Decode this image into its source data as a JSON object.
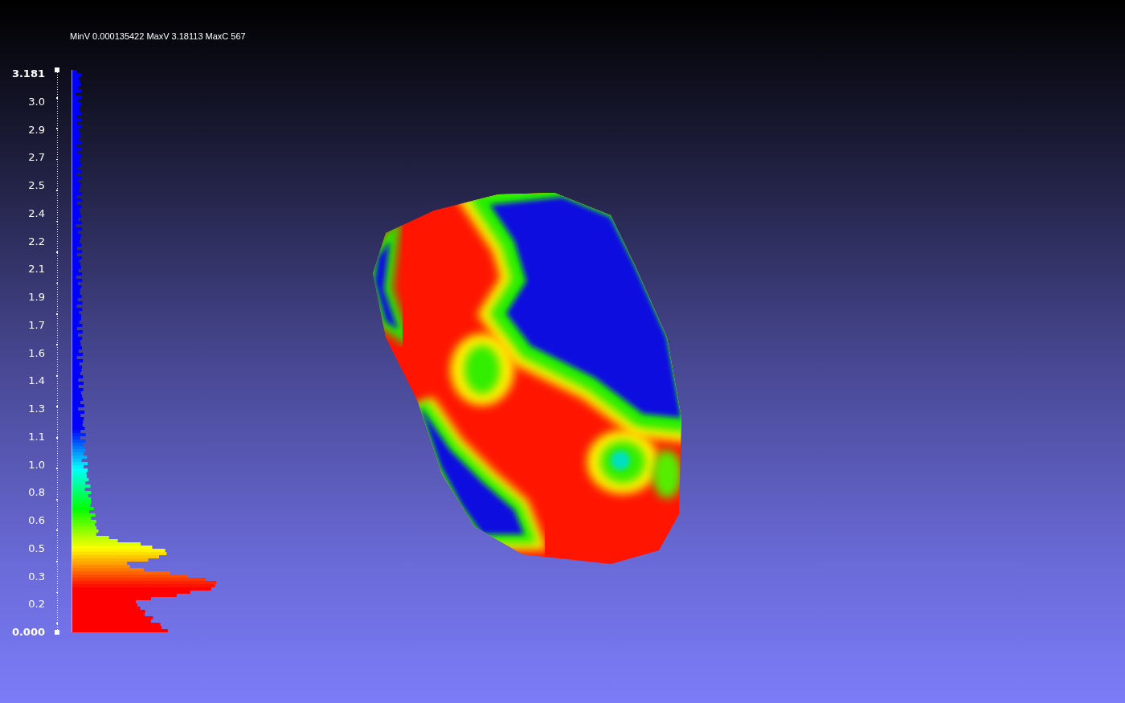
{
  "info_text": "MinV 0.000135422 MaxV 3.18113 MaxC 567",
  "colorbar": {
    "ticks": [
      "3.181",
      "3.0",
      "2.9",
      "2.7",
      "2.5",
      "2.4",
      "2.2",
      "2.1",
      "1.9",
      "1.7",
      "1.6",
      "1.4",
      "1.3",
      "1.1",
      "1.0",
      "0.8",
      "0.6",
      "0.5",
      "0.3",
      "0.2",
      "0.000"
    ]
  }
}
